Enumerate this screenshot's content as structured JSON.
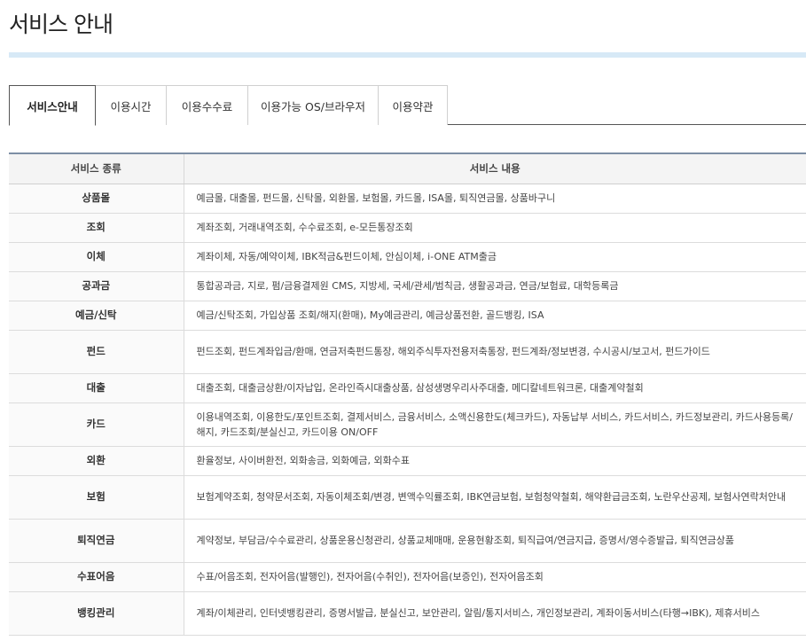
{
  "page": {
    "title": "서비스 안내"
  },
  "tabs": [
    {
      "label": "서비스안내",
      "active": true
    },
    {
      "label": "이용시간",
      "active": false
    },
    {
      "label": "이용수수료",
      "active": false
    },
    {
      "label": "이용가능 OS/브라우저",
      "active": false
    },
    {
      "label": "이용약관",
      "active": false
    }
  ],
  "table": {
    "headers": [
      "서비스 종류",
      "서비스 내용"
    ],
    "rows": [
      {
        "kind": "상품몰",
        "desc": "예금몰, 대출몰, 펀드몰, 신탁몰, 외환몰, 보험몰, 카드몰, ISA몰, 퇴직연금몰, 상품바구니"
      },
      {
        "kind": "조회",
        "desc": "계좌조회, 거래내역조회, 수수료조회, e-모든통장조회"
      },
      {
        "kind": "이체",
        "desc": "계좌이체, 자동/예약이체, IBK적금&펀드이체, 안심이체, i-ONE ATM출금"
      },
      {
        "kind": "공과금",
        "desc": "통합공과금, 지로, 펌/금융결제원 CMS, 지방세, 국세/관세/범칙금, 생활공과금, 연금/보험료, 대학등록금"
      },
      {
        "kind": "예금/신탁",
        "desc": "예금/신탁조회, 가입상품 조회/해지(환매), My예금관리, 예금상품전환, 골드뱅킹, ISA"
      },
      {
        "kind": "펀드",
        "desc": "펀드조회, 펀드계좌입금/환매, 연금저축펀드통장, 해외주식투자전용저축통장, 펀드계좌/정보변경, 수시공시/보고서, 펀드가이드"
      },
      {
        "kind": "대출",
        "desc": "대출조회, 대출금상환/이자납입, 온라인즉시대출상품, 삼성생명우리사주대출, 메디칼네트워크론, 대출계약철회"
      },
      {
        "kind": "카드",
        "desc": "이용내역조회, 이용한도/포인트조회, 결제서비스, 금융서비스, 소액신용한도(체크카드), 자동납부 서비스, 카드서비스, 카드정보관리, 카드사용등록/해지, 카드조회/분실신고, 카드이용 ON/OFF"
      },
      {
        "kind": "외환",
        "desc": "환율정보, 사이버환전, 외화송금, 외화예금, 외화수표"
      },
      {
        "kind": "보험",
        "desc": "보험계약조회, 청약문서조회, 자동이체조회/변경, 변액수익률조회, IBK연금보험, 보험청약철회, 해약환급금조회, 노란우산공제, 보험사연락처안내"
      },
      {
        "kind": "퇴직연금",
        "desc": "계약정보, 부담금/수수료관리, 상품운용신청관리, 상품교체매매, 운용현황조회, 퇴직급여/연금지급, 증명서/영수증발급, 퇴직연금상품"
      },
      {
        "kind": "수표어음",
        "desc": "수표/어음조회, 전자어음(발행인), 전자어음(수취인), 전자어음(보증인), 전자어음조회"
      },
      {
        "kind": "뱅킹관리",
        "desc": "계좌/이체관리, 인터넷뱅킹관리, 증명서발급, 분실신고, 보안관리, 알림/통지서비스, 개인정보관리, 계좌이동서비스(타행→IBK), 제휴서비스"
      }
    ]
  }
}
